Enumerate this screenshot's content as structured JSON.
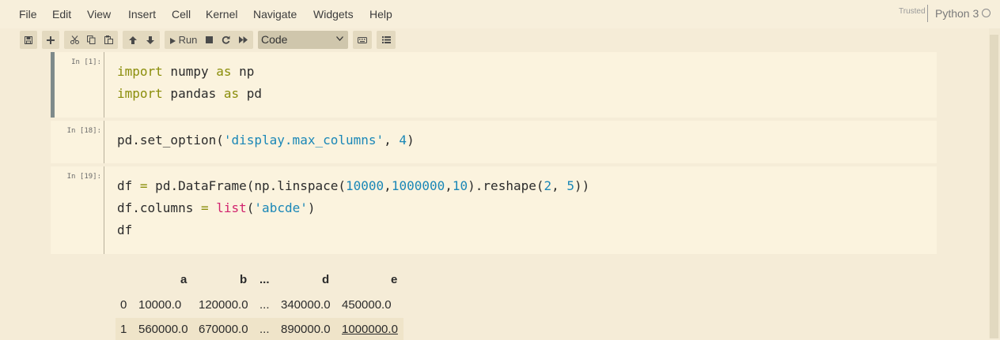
{
  "menubar": {
    "items": [
      "File",
      "Edit",
      "View",
      "Insert",
      "Cell",
      "Kernel",
      "Navigate",
      "Widgets",
      "Help"
    ],
    "trusted": "Trusted",
    "kernel": "Python 3"
  },
  "toolbar": {
    "run_label": "Run",
    "cell_type": "Code",
    "icons": [
      "save-icon",
      "add-cell-icon",
      "cut-icon",
      "copy-icon",
      "paste-icon",
      "move-up-icon",
      "move-down-icon",
      "run-icon",
      "stop-icon",
      "restart-icon",
      "fast-forward-icon",
      "keyboard-icon",
      "list-icon"
    ]
  },
  "cells": [
    {
      "prompt": "In [1]:",
      "lines": [
        "import numpy as np",
        "import pandas as pd"
      ]
    },
    {
      "prompt": "In [18]:",
      "lines": [
        "pd.set_option('display.max_columns', 4)"
      ]
    },
    {
      "prompt": "In [19]:",
      "lines": [
        "df = pd.DataFrame(np.linspace(10000,1000000,10).reshape(2, 5))",
        "df.columns = list('abcde')",
        "df"
      ]
    }
  ],
  "dataframe": {
    "columns": [
      "",
      "a",
      "b",
      "...",
      "d",
      "e"
    ],
    "rows": [
      [
        "0",
        "10000.0",
        "120000.0",
        "...",
        "340000.0",
        "450000.0"
      ],
      [
        "1",
        "560000.0",
        "670000.0",
        "...",
        "890000.0",
        "1000000.0"
      ]
    ]
  },
  "colors": {
    "background": "#f5ecd7",
    "cell_bg": "#fbf3de",
    "keyword": "#8a8d0a",
    "string": "#1a87b7",
    "builtin": "#d1236e"
  }
}
